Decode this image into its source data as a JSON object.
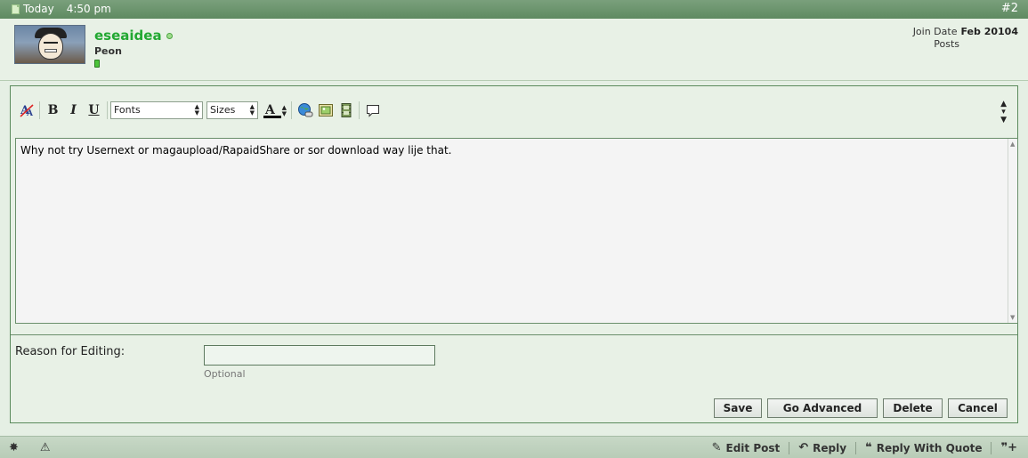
{
  "post_header": {
    "date": "Today",
    "time": "4:50 pm",
    "post_number": "#2"
  },
  "user": {
    "name": "eseaidea",
    "title": "Peon",
    "join_date_label": "Join Date",
    "join_date": "Feb 20104",
    "posts_label": "Posts",
    "posts_count": ""
  },
  "toolbar": {
    "fonts_select": "Fonts",
    "sizes_select": "Sizes"
  },
  "editor": {
    "text": "Why not try Usernext or magaupload/RapaidShare or sor download way lije that."
  },
  "reason": {
    "label": "Reason for Editing:",
    "value": "",
    "hint": "Optional"
  },
  "buttons": {
    "save": "Save",
    "go_advanced": "Go Advanced",
    "delete": "Delete",
    "cancel": "Cancel"
  },
  "footer": {
    "edit_post": "Edit Post",
    "reply": "Reply",
    "reply_with_quote": "Reply With Quote"
  },
  "colors": {
    "header_green": "#6a936c",
    "username_green": "#22a832",
    "background": "#e5efe4"
  }
}
